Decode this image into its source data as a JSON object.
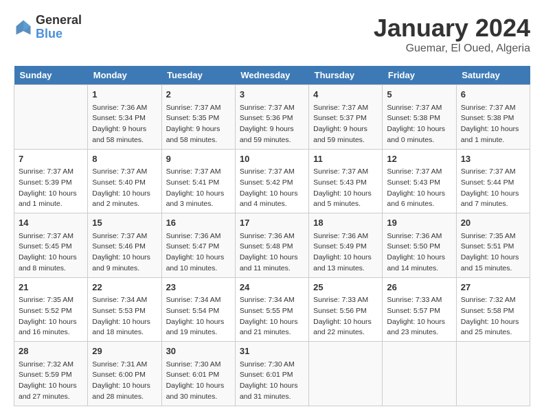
{
  "header": {
    "logo_line1": "General",
    "logo_line2": "Blue",
    "month_title": "January 2024",
    "subtitle": "Guemar, El Oued, Algeria"
  },
  "weekdays": [
    "Sunday",
    "Monday",
    "Tuesday",
    "Wednesday",
    "Thursday",
    "Friday",
    "Saturday"
  ],
  "weeks": [
    [
      {
        "day": "",
        "sunrise": "",
        "sunset": "",
        "daylight": ""
      },
      {
        "day": "1",
        "sunrise": "Sunrise: 7:36 AM",
        "sunset": "Sunset: 5:34 PM",
        "daylight": "Daylight: 9 hours and 58 minutes."
      },
      {
        "day": "2",
        "sunrise": "Sunrise: 7:37 AM",
        "sunset": "Sunset: 5:35 PM",
        "daylight": "Daylight: 9 hours and 58 minutes."
      },
      {
        "day": "3",
        "sunrise": "Sunrise: 7:37 AM",
        "sunset": "Sunset: 5:36 PM",
        "daylight": "Daylight: 9 hours and 59 minutes."
      },
      {
        "day": "4",
        "sunrise": "Sunrise: 7:37 AM",
        "sunset": "Sunset: 5:37 PM",
        "daylight": "Daylight: 9 hours and 59 minutes."
      },
      {
        "day": "5",
        "sunrise": "Sunrise: 7:37 AM",
        "sunset": "Sunset: 5:38 PM",
        "daylight": "Daylight: 10 hours and 0 minutes."
      },
      {
        "day": "6",
        "sunrise": "Sunrise: 7:37 AM",
        "sunset": "Sunset: 5:38 PM",
        "daylight": "Daylight: 10 hours and 1 minute."
      }
    ],
    [
      {
        "day": "7",
        "sunrise": "Sunrise: 7:37 AM",
        "sunset": "Sunset: 5:39 PM",
        "daylight": "Daylight: 10 hours and 1 minute."
      },
      {
        "day": "8",
        "sunrise": "Sunrise: 7:37 AM",
        "sunset": "Sunset: 5:40 PM",
        "daylight": "Daylight: 10 hours and 2 minutes."
      },
      {
        "day": "9",
        "sunrise": "Sunrise: 7:37 AM",
        "sunset": "Sunset: 5:41 PM",
        "daylight": "Daylight: 10 hours and 3 minutes."
      },
      {
        "day": "10",
        "sunrise": "Sunrise: 7:37 AM",
        "sunset": "Sunset: 5:42 PM",
        "daylight": "Daylight: 10 hours and 4 minutes."
      },
      {
        "day": "11",
        "sunrise": "Sunrise: 7:37 AM",
        "sunset": "Sunset: 5:43 PM",
        "daylight": "Daylight: 10 hours and 5 minutes."
      },
      {
        "day": "12",
        "sunrise": "Sunrise: 7:37 AM",
        "sunset": "Sunset: 5:43 PM",
        "daylight": "Daylight: 10 hours and 6 minutes."
      },
      {
        "day": "13",
        "sunrise": "Sunrise: 7:37 AM",
        "sunset": "Sunset: 5:44 PM",
        "daylight": "Daylight: 10 hours and 7 minutes."
      }
    ],
    [
      {
        "day": "14",
        "sunrise": "Sunrise: 7:37 AM",
        "sunset": "Sunset: 5:45 PM",
        "daylight": "Daylight: 10 hours and 8 minutes."
      },
      {
        "day": "15",
        "sunrise": "Sunrise: 7:37 AM",
        "sunset": "Sunset: 5:46 PM",
        "daylight": "Daylight: 10 hours and 9 minutes."
      },
      {
        "day": "16",
        "sunrise": "Sunrise: 7:36 AM",
        "sunset": "Sunset: 5:47 PM",
        "daylight": "Daylight: 10 hours and 10 minutes."
      },
      {
        "day": "17",
        "sunrise": "Sunrise: 7:36 AM",
        "sunset": "Sunset: 5:48 PM",
        "daylight": "Daylight: 10 hours and 11 minutes."
      },
      {
        "day": "18",
        "sunrise": "Sunrise: 7:36 AM",
        "sunset": "Sunset: 5:49 PM",
        "daylight": "Daylight: 10 hours and 13 minutes."
      },
      {
        "day": "19",
        "sunrise": "Sunrise: 7:36 AM",
        "sunset": "Sunset: 5:50 PM",
        "daylight": "Daylight: 10 hours and 14 minutes."
      },
      {
        "day": "20",
        "sunrise": "Sunrise: 7:35 AM",
        "sunset": "Sunset: 5:51 PM",
        "daylight": "Daylight: 10 hours and 15 minutes."
      }
    ],
    [
      {
        "day": "21",
        "sunrise": "Sunrise: 7:35 AM",
        "sunset": "Sunset: 5:52 PM",
        "daylight": "Daylight: 10 hours and 16 minutes."
      },
      {
        "day": "22",
        "sunrise": "Sunrise: 7:34 AM",
        "sunset": "Sunset: 5:53 PM",
        "daylight": "Daylight: 10 hours and 18 minutes."
      },
      {
        "day": "23",
        "sunrise": "Sunrise: 7:34 AM",
        "sunset": "Sunset: 5:54 PM",
        "daylight": "Daylight: 10 hours and 19 minutes."
      },
      {
        "day": "24",
        "sunrise": "Sunrise: 7:34 AM",
        "sunset": "Sunset: 5:55 PM",
        "daylight": "Daylight: 10 hours and 21 minutes."
      },
      {
        "day": "25",
        "sunrise": "Sunrise: 7:33 AM",
        "sunset": "Sunset: 5:56 PM",
        "daylight": "Daylight: 10 hours and 22 minutes."
      },
      {
        "day": "26",
        "sunrise": "Sunrise: 7:33 AM",
        "sunset": "Sunset: 5:57 PM",
        "daylight": "Daylight: 10 hours and 23 minutes."
      },
      {
        "day": "27",
        "sunrise": "Sunrise: 7:32 AM",
        "sunset": "Sunset: 5:58 PM",
        "daylight": "Daylight: 10 hours and 25 minutes."
      }
    ],
    [
      {
        "day": "28",
        "sunrise": "Sunrise: 7:32 AM",
        "sunset": "Sunset: 5:59 PM",
        "daylight": "Daylight: 10 hours and 27 minutes."
      },
      {
        "day": "29",
        "sunrise": "Sunrise: 7:31 AM",
        "sunset": "Sunset: 6:00 PM",
        "daylight": "Daylight: 10 hours and 28 minutes."
      },
      {
        "day": "30",
        "sunrise": "Sunrise: 7:30 AM",
        "sunset": "Sunset: 6:01 PM",
        "daylight": "Daylight: 10 hours and 30 minutes."
      },
      {
        "day": "31",
        "sunrise": "Sunrise: 7:30 AM",
        "sunset": "Sunset: 6:01 PM",
        "daylight": "Daylight: 10 hours and 31 minutes."
      },
      {
        "day": "",
        "sunrise": "",
        "sunset": "",
        "daylight": ""
      },
      {
        "day": "",
        "sunrise": "",
        "sunset": "",
        "daylight": ""
      },
      {
        "day": "",
        "sunrise": "",
        "sunset": "",
        "daylight": ""
      }
    ]
  ]
}
